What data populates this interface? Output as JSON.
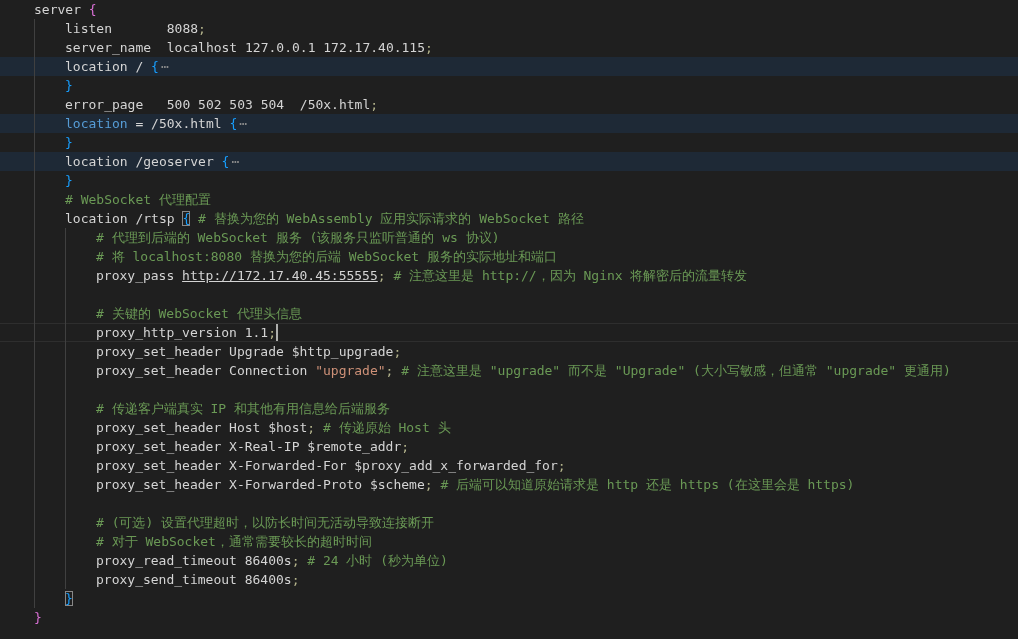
{
  "editor": {
    "lines": [
      {
        "tokens": [
          {
            "kind": "plain",
            "text": "server "
          },
          {
            "kind": "brace1",
            "text": "{"
          }
        ],
        "children": [
          {
            "tokens": [
              {
                "kind": "plain",
                "text": "listen       8088"
              },
              {
                "kind": "semi",
                "text": ";"
              }
            ]
          },
          {
            "tokens": [
              {
                "kind": "plain",
                "text": "server_name  localhost 127.0.0.1 172.17.40.115"
              },
              {
                "kind": "semi",
                "text": ";"
              }
            ]
          },
          {
            "highlighted": true,
            "tokens": [
              {
                "kind": "plain",
                "text": "location / "
              },
              {
                "kind": "brace2",
                "text": "{"
              },
              {
                "kind": "ellipsis",
                "text": "⋯"
              }
            ]
          },
          {
            "tokens": [
              {
                "kind": "brace2",
                "text": "}"
              }
            ]
          },
          {
            "tokens": [
              {
                "kind": "plain",
                "text": "error_page   500 502 503 504  /50x.html"
              },
              {
                "kind": "semi",
                "text": ";"
              }
            ]
          },
          {
            "highlighted": true,
            "tokens": [
              {
                "kind": "keyword",
                "text": "location"
              },
              {
                "kind": "plain",
                "text": " = /50x.html "
              },
              {
                "kind": "brace2",
                "text": "{"
              },
              {
                "kind": "ellipsis",
                "text": "⋯"
              }
            ]
          },
          {
            "tokens": [
              {
                "kind": "brace2",
                "text": "}"
              }
            ]
          },
          {
            "highlighted": true,
            "tokens": [
              {
                "kind": "plain",
                "text": "location /geoserver "
              },
              {
                "kind": "brace2",
                "text": "{"
              },
              {
                "kind": "ellipsis",
                "text": "⋯"
              }
            ]
          },
          {
            "tokens": [
              {
                "kind": "brace2",
                "text": "}"
              }
            ]
          },
          {
            "tokens": [
              {
                "kind": "comment",
                "text": "# WebSocket 代理配置"
              }
            ]
          },
          {
            "tokens": [
              {
                "kind": "plain",
                "text": "location /rtsp "
              },
              {
                "kind": "brace2",
                "text": "{",
                "matched": true
              },
              {
                "kind": "comment",
                "text": " # 替换为您的 WebAssembly 应用实际请求的 WebSocket 路径"
              }
            ],
            "children": [
              {
                "tokens": [
                  {
                    "kind": "comment",
                    "text": "# 代理到后端的 WebSocket 服务 (该服务只监听普通的 ws 协议)"
                  }
                ]
              },
              {
                "tokens": [
                  {
                    "kind": "comment",
                    "text": "# 将 localhost:8080 替换为您的后端 WebSocket 服务的实际地址和端口"
                  }
                ]
              },
              {
                "tokens": [
                  {
                    "kind": "plain",
                    "text": "proxy_pass "
                  },
                  {
                    "kind": "link",
                    "text": "http://172.17.40.45:55555"
                  },
                  {
                    "kind": "semi",
                    "text": ";"
                  },
                  {
                    "kind": "comment",
                    "text": " # 注意这里是 http://，因为 Nginx 将解密后的流量转发"
                  }
                ]
              },
              {
                "kind": "blank"
              },
              {
                "tokens": [
                  {
                    "kind": "comment",
                    "text": "# 关键的 WebSocket 代理头信息"
                  }
                ]
              },
              {
                "current": true,
                "cursor": true,
                "tokens": [
                  {
                    "kind": "plain",
                    "text": "proxy_http_version 1.1"
                  },
                  {
                    "kind": "semi",
                    "text": ";"
                  }
                ]
              },
              {
                "tokens": [
                  {
                    "kind": "plain",
                    "text": "proxy_set_header Upgrade $http_upgrade"
                  },
                  {
                    "kind": "semi",
                    "text": ";"
                  }
                ]
              },
              {
                "tokens": [
                  {
                    "kind": "plain",
                    "text": "proxy_set_header Connection "
                  },
                  {
                    "kind": "string",
                    "text": "\"upgrade\""
                  },
                  {
                    "kind": "semi",
                    "text": ";"
                  },
                  {
                    "kind": "comment",
                    "text": " # 注意这里是 \"upgrade\" 而不是 \"Upgrade\" (大小写敏感，但通常 \"upgrade\" 更通用)"
                  }
                ]
              },
              {
                "kind": "blank"
              },
              {
                "tokens": [
                  {
                    "kind": "comment",
                    "text": "# 传递客户端真实 IP 和其他有用信息给后端服务"
                  }
                ]
              },
              {
                "tokens": [
                  {
                    "kind": "plain",
                    "text": "proxy_set_header Host $host"
                  },
                  {
                    "kind": "semi",
                    "text": ";"
                  },
                  {
                    "kind": "comment",
                    "text": " # 传递原始 Host 头"
                  }
                ]
              },
              {
                "tokens": [
                  {
                    "kind": "plain",
                    "text": "proxy_set_header X-Real-IP $remote_addr"
                  },
                  {
                    "kind": "semi",
                    "text": ";"
                  }
                ]
              },
              {
                "tokens": [
                  {
                    "kind": "plain",
                    "text": "proxy_set_header X-Forwarded-For $proxy_add_x_forwarded_for"
                  },
                  {
                    "kind": "semi",
                    "text": ";"
                  }
                ]
              },
              {
                "tokens": [
                  {
                    "kind": "plain",
                    "text": "proxy_set_header X-Forwarded-Proto $scheme"
                  },
                  {
                    "kind": "semi",
                    "text": ";"
                  },
                  {
                    "kind": "comment",
                    "text": " # 后端可以知道原始请求是 http 还是 https (在这里会是 https)"
                  }
                ]
              },
              {
                "kind": "blank"
              },
              {
                "tokens": [
                  {
                    "kind": "comment",
                    "text": "# (可选) 设置代理超时，以防长时间无活动导致连接断开"
                  }
                ]
              },
              {
                "tokens": [
                  {
                    "kind": "comment",
                    "text": "# 对于 WebSocket，通常需要较长的超时时间"
                  }
                ]
              },
              {
                "tokens": [
                  {
                    "kind": "plain",
                    "text": "proxy_read_timeout 86400s"
                  },
                  {
                    "kind": "semi",
                    "text": ";"
                  },
                  {
                    "kind": "comment",
                    "text": " # 24 小时 (秒为单位)"
                  }
                ]
              },
              {
                "tokens": [
                  {
                    "kind": "plain",
                    "text": "proxy_send_timeout 86400s"
                  },
                  {
                    "kind": "semi",
                    "text": ";"
                  }
                ]
              }
            ]
          },
          {
            "tokens": [
              {
                "kind": "brace2",
                "text": "}",
                "matched": true
              }
            ]
          }
        ]
      },
      {
        "tokens": [
          {
            "kind": "brace1",
            "text": "}"
          }
        ]
      }
    ]
  }
}
